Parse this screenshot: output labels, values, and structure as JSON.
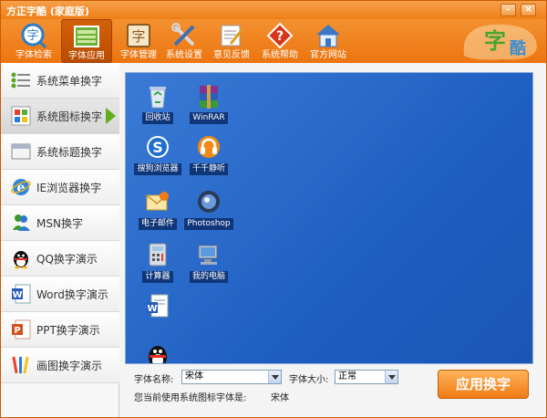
{
  "window": {
    "title": "方正字酷 (家庭版)"
  },
  "toolbar": {
    "items": [
      {
        "label": "字体检索",
        "icon": "font-search-icon"
      },
      {
        "label": "字体应用",
        "icon": "font-apply-icon",
        "active": true
      },
      {
        "label": "字体管理",
        "icon": "font-manage-icon"
      },
      {
        "label": "系统设置",
        "icon": "tools-icon"
      },
      {
        "label": "意见反馈",
        "icon": "feedback-icon"
      },
      {
        "label": "系统帮助",
        "icon": "help-icon"
      },
      {
        "label": "官方网站",
        "icon": "home-icon"
      }
    ],
    "logo_text": "字酷"
  },
  "sidebar": {
    "items": [
      {
        "label": "系统菜单换字",
        "icon": "menu-icon"
      },
      {
        "label": "系统图标换字",
        "icon": "windows-icon",
        "active": true
      },
      {
        "label": "系统标题换字",
        "icon": "title-bar-icon"
      },
      {
        "label": "IE浏览器换字",
        "icon": "ie-icon"
      },
      {
        "label": "MSN换字",
        "icon": "msn-icon"
      },
      {
        "label": "QQ换字演示",
        "icon": "qq-icon"
      },
      {
        "label": "Word换字演示",
        "icon": "word-icon"
      },
      {
        "label": "PPT换字演示",
        "icon": "ppt-icon"
      },
      {
        "label": "画图换字演示",
        "icon": "paint-icon"
      }
    ]
  },
  "desktop": {
    "icons": [
      {
        "label": "回收站",
        "icon": "recycle-bin-icon"
      },
      {
        "label": "WinRAR",
        "icon": "winrar-icon"
      },
      {
        "label": "搜狗浏览器",
        "icon": "sogou-browser-icon"
      },
      {
        "label": "千千静听",
        "icon": "ttplayer-icon"
      },
      {
        "label": "电子邮件",
        "icon": "email-icon"
      },
      {
        "label": "Photoshop",
        "icon": "photoshop-icon"
      },
      {
        "label": "计算器",
        "icon": "calculator-icon"
      },
      {
        "label": "我的电脑",
        "icon": "my-computer-icon"
      },
      {
        "label": "",
        "icon": "word-doc-icon"
      },
      {
        "label": "",
        "icon": "qq-penguin-icon"
      }
    ]
  },
  "settings": {
    "font_name_label": "字体名称:",
    "font_name_value": "宋体",
    "font_size_label": "字体大小:",
    "font_size_value": "正常",
    "current_font_label": "您当前使用系统图标字体是:",
    "current_font_value": "宋体",
    "apply_label": "应用换字"
  },
  "colors": {
    "brand_orange": "#f08a22",
    "desktop_blue": "#2a68c9",
    "active_arrow": "#5fae1a"
  }
}
